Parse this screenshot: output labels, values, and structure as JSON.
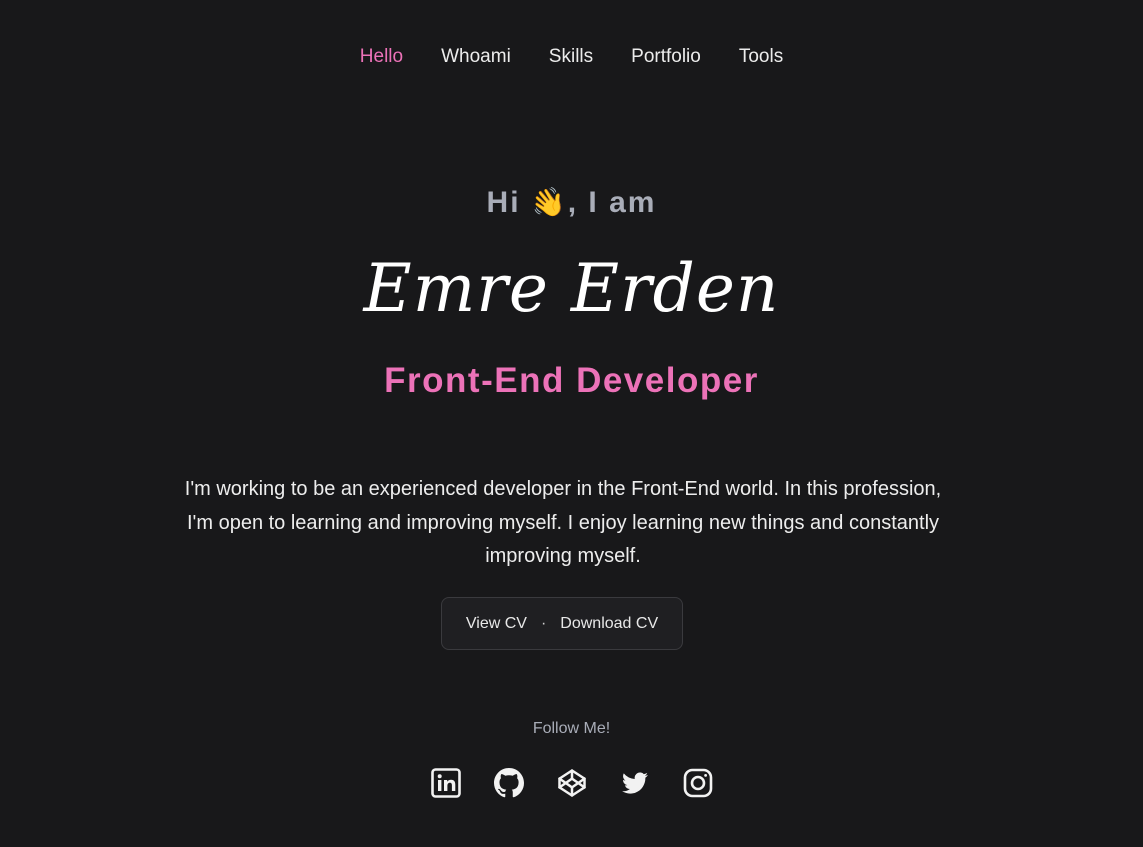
{
  "nav": {
    "items": [
      {
        "label": "Hello",
        "active": true
      },
      {
        "label": "Whoami",
        "active": false
      },
      {
        "label": "Skills",
        "active": false
      },
      {
        "label": "Portfolio",
        "active": false
      },
      {
        "label": "Tools",
        "active": false
      }
    ]
  },
  "hero": {
    "greeting_before": "Hi ",
    "greeting_emoji": "👋",
    "greeting_after": ", I am",
    "name": "Emre Erden",
    "role": "Front-End Developer",
    "bio": "I'm working to be an experienced developer in the Front-End world. In this profession, I'm open to learning and improving myself. I enjoy learning new things and constantly improving myself."
  },
  "cv": {
    "view_label": "View CV",
    "separator": "·",
    "download_label": "Download CV"
  },
  "follow": {
    "label": "Follow Me!",
    "icons": [
      "linkedin-icon",
      "github-icon",
      "codepen-icon",
      "twitter-icon",
      "instagram-icon"
    ]
  },
  "colors": {
    "background": "#18181a",
    "accent": "#ec72b8",
    "muted": "#a9adb8",
    "text": "#ececec"
  }
}
